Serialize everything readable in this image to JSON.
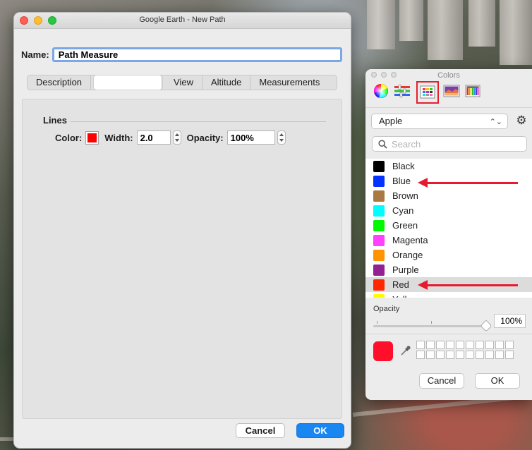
{
  "dialog": {
    "title": "Google Earth - New Path",
    "name_label": "Name:",
    "name_value": "Path Measure",
    "tabs": [
      "Description",
      "",
      "View",
      "Altitude",
      "Measurements"
    ],
    "group_title": "Lines",
    "color_label": "Color:",
    "color_value": "#ff0000",
    "width_label": "Width:",
    "width_value": "2.0",
    "opacity_label": "Opacity:",
    "opacity_value": "100%",
    "cancel_label": "Cancel",
    "ok_label": "OK"
  },
  "colors_panel": {
    "title": "Colors",
    "palette_selected": "Apple",
    "search_placeholder": "Search",
    "items": [
      {
        "name": "Black",
        "color": "#000000"
      },
      {
        "name": "Blue",
        "color": "#0433ff"
      },
      {
        "name": "Brown",
        "color": "#aa7942"
      },
      {
        "name": "Cyan",
        "color": "#00fdff"
      },
      {
        "name": "Green",
        "color": "#00f900"
      },
      {
        "name": "Magenta",
        "color": "#ff40ff"
      },
      {
        "name": "Orange",
        "color": "#ff9300"
      },
      {
        "name": "Purple",
        "color": "#942192"
      },
      {
        "name": "Red",
        "color": "#ff2600"
      },
      {
        "name": "Yellow",
        "color": "#fffb00"
      }
    ],
    "selected_item": "Red",
    "opacity_label": "Opacity",
    "opacity_value": "100%",
    "current_color": "#ff0f2a",
    "cancel_label": "Cancel",
    "ok_label": "OK"
  },
  "annotations": {
    "arrow_color": "#e61b30",
    "highlight_color": "#e4202f"
  }
}
